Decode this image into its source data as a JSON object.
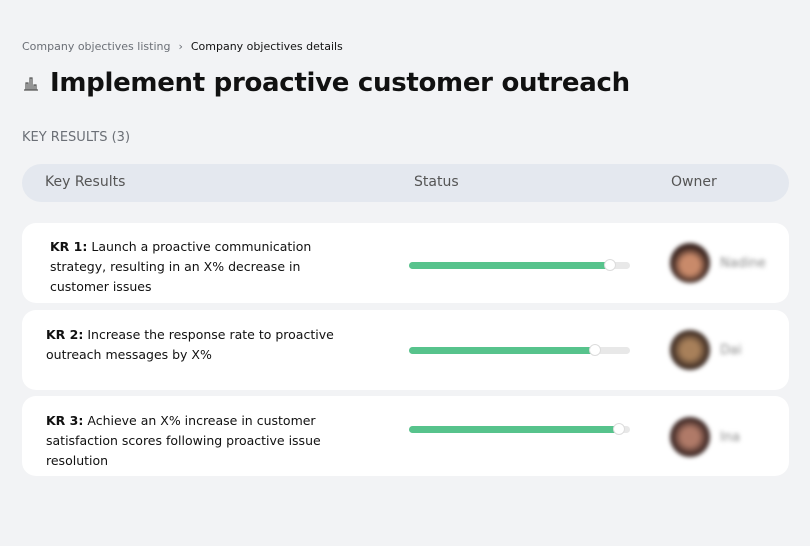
{
  "breadcrumb": {
    "parent": "Company objectives listing",
    "separator": "›",
    "current": "Company objectives details"
  },
  "page": {
    "title": "Implement proactive customer outreach",
    "icon": "building-chart-icon"
  },
  "section": {
    "label": "KEY RESULTS (3)"
  },
  "table": {
    "headers": {
      "key_results": "Key Results",
      "status": "Status",
      "owner": "Owner"
    },
    "rows": [
      {
        "id": "KR 1:",
        "text": "Launch a proactive communication strategy, resulting in an X% decrease in customer issues",
        "progress_percent": 91,
        "owner": "Nadine"
      },
      {
        "id": "KR 2:",
        "text": "Increase the response rate to proactive outreach messages by X%",
        "progress_percent": 84,
        "owner": "Dai"
      },
      {
        "id": "KR 3:",
        "text": "Achieve an X% increase in customer satisfaction scores following proactive issue resolution",
        "progress_percent": 95,
        "owner": "Ina"
      }
    ]
  },
  "colors": {
    "progress": "#57c38c",
    "track": "#e8e8e8",
    "header_bg": "#e4e8ef",
    "page_bg": "#f2f3f5"
  }
}
